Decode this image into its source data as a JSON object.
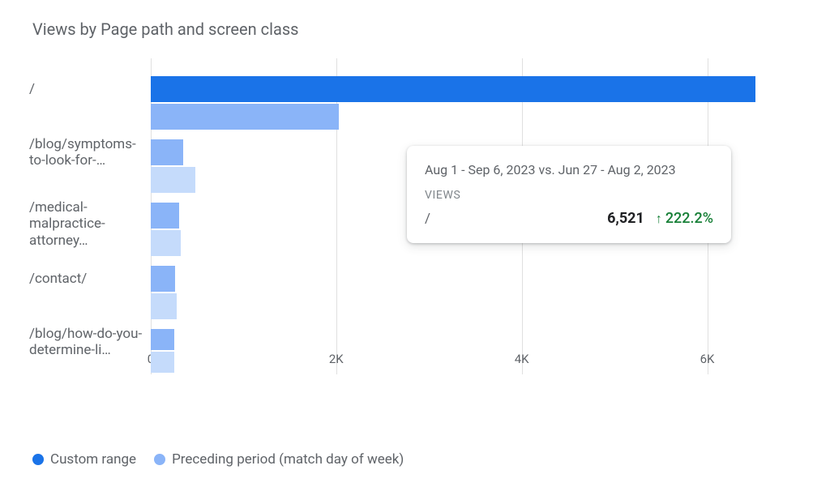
{
  "title": "Views by Page path and screen class",
  "chart_data": {
    "type": "bar",
    "xlabel": "",
    "ylabel": "",
    "xlim": [
      0,
      6800
    ],
    "x_ticks": [
      0,
      2000,
      4000,
      6000
    ],
    "x_tick_labels": [
      "0",
      "2K",
      "4K",
      "6K"
    ],
    "categories": [
      "/",
      "/blog/symptoms-to-look-for-…",
      "/medical-malpractice-attorney…",
      "/contact/",
      "/blog/how-do-you-determine-li…"
    ],
    "series": [
      {
        "name": "Custom range",
        "color": "#1a73e8",
        "values": [
          6521,
          350,
          310,
          260,
          250
        ]
      },
      {
        "name": "Preceding period (match day of week)",
        "color": "#8ab4f8",
        "values": [
          2024,
          480,
          320,
          280,
          250
        ]
      }
    ]
  },
  "tooltip": {
    "date_range": "Aug 1 - Sep 6, 2023 vs. Jun 27 - Aug 2, 2023",
    "metric_label": "VIEWS",
    "path": "/",
    "value": "6,521",
    "delta": "222.2%",
    "delta_direction": "up"
  },
  "legend": {
    "items": [
      {
        "label": "Custom range",
        "color": "#1a73e8"
      },
      {
        "label": "Preceding period (match day of week)",
        "color": "#8ab4f8"
      }
    ]
  }
}
